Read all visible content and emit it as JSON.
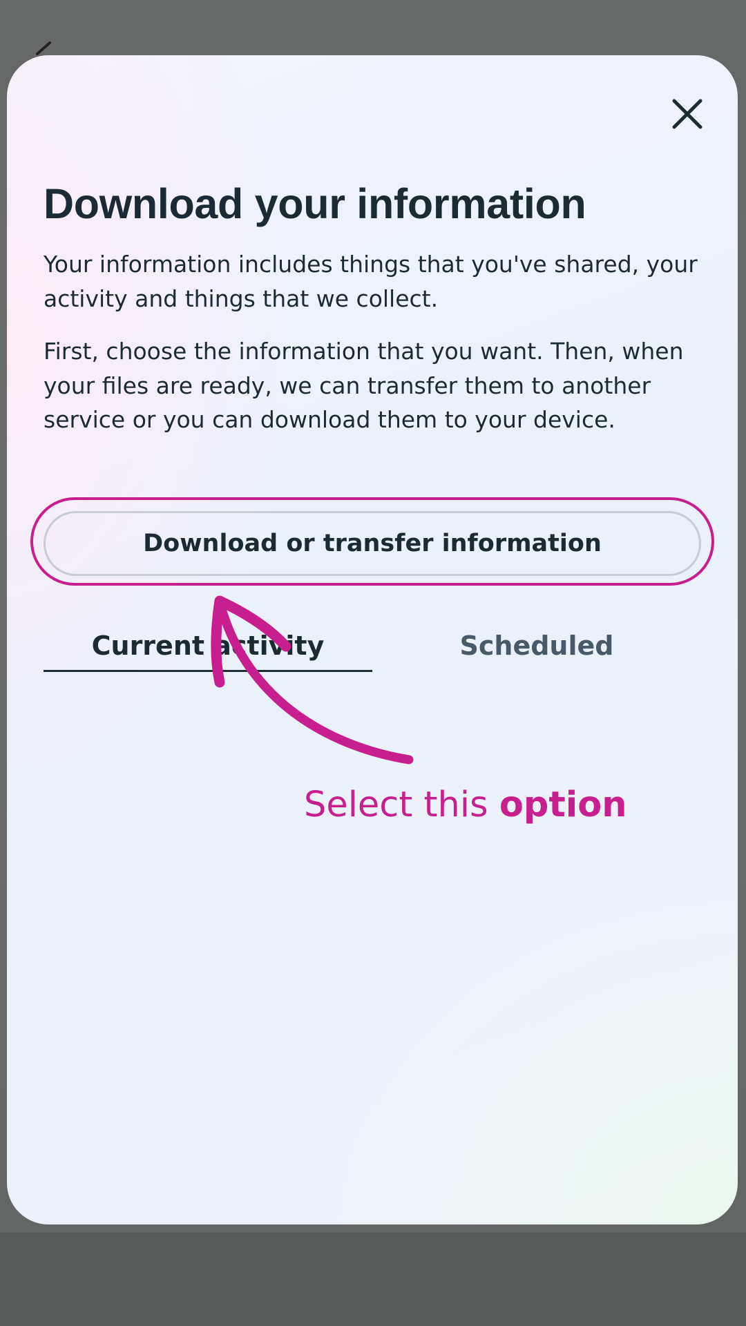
{
  "modal": {
    "title": "Download your information",
    "paragraph1": "Your information includes things that you've shared, your activity and things that we collect.",
    "paragraph2": "First, choose the information that you want. Then, when your files are ready, we can transfer them to another service or you can download them to your device.",
    "primary_button_label": "Download or transfer information",
    "close_icon": "close-icon"
  },
  "tabs": [
    {
      "label": "Current activity",
      "selected": true
    },
    {
      "label": "Scheduled",
      "selected": false
    }
  ],
  "annotation": {
    "text_regular": "Select this ",
    "text_bold": "option",
    "color": "#c81f8f"
  },
  "colors": {
    "text_primary": "#1c2b33",
    "text_secondary": "#465a69",
    "highlight": "#c81f8f",
    "backdrop": "#666868"
  }
}
